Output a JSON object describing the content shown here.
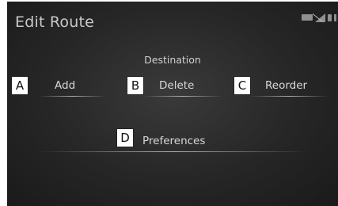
{
  "window": {
    "title": "Edit Route"
  },
  "status_icons": [
    "ec-icon",
    "signal-icon",
    "battery-icon",
    "bluetooth-icon"
  ],
  "destination": {
    "section_title": "Destination",
    "buttons": [
      {
        "label": "Add",
        "marker": "A"
      },
      {
        "label": "Delete",
        "marker": "B"
      },
      {
        "label": "Reorder",
        "marker": "C"
      }
    ]
  },
  "preferences": {
    "label": "Preferences",
    "marker": "D"
  }
}
